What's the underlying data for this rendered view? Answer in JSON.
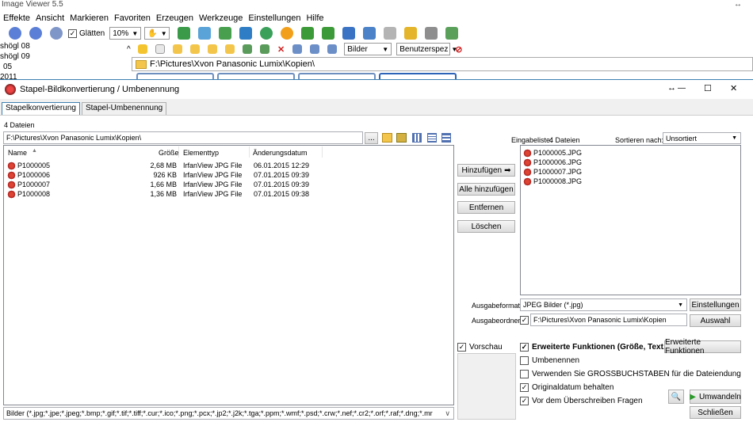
{
  "app": {
    "title": "Image Viewer 5.5",
    "maximize_glyph": "↔"
  },
  "menu": [
    "Effekte",
    "Ansicht",
    "Markieren",
    "Favoriten",
    "Erzeugen",
    "Werkzeuge",
    "Einstellungen",
    "Hilfe"
  ],
  "toolbar": {
    "smooth_label": "Glätten",
    "zoom_value": "10%",
    "view_mode": "Bilder",
    "sort_mode": "Benutzerspez"
  },
  "tree": [
    "shögl 08",
    "shögl 09",
    "05",
    "2011"
  ],
  "browser_path": "F:\\Pictures\\Xvon Panasonic Lumix\\Kopien\\",
  "dialog": {
    "title": "Stapel-Bildkonvertierung / Umbenennung",
    "window_controls": {
      "resize": "↔",
      "minimize": "—",
      "maximize": "☐",
      "close": "✕"
    },
    "tabs": [
      "Stapelkonvertierung",
      "Stapel-Umbenennung"
    ],
    "file_count": "4 Dateien",
    "path": "F:\\Pictures\\Xvon Panasonic Lumix\\Kopien\\",
    "browse_label": "...",
    "columns": {
      "name": "Name",
      "size": "Größe",
      "type": "Elementtyp",
      "date": "Änderungsdatum",
      "sort_glyph": "▲"
    },
    "files": [
      {
        "name": "P1000005",
        "size": "2,68 MB",
        "type": "IrfanView JPG File",
        "date": "06.01.2015 12:29"
      },
      {
        "name": "P1000006",
        "size": "926 KB",
        "type": "IrfanView JPG File",
        "date": "07.01.2015 09:39"
      },
      {
        "name": "P1000007",
        "size": "1,66 MB",
        "type": "IrfanView JPG File",
        "date": "07.01.2015 09:39"
      },
      {
        "name": "P1000008",
        "size": "1,36 MB",
        "type": "IrfanView JPG File",
        "date": "07.01.2015 09:38"
      }
    ],
    "filter": "Bilder (*.jpg;*.jpe;*.jpeg;*.bmp;*.gif;*.tif;*.tiff;*.cur;*.ico;*.png;*.pcx;*.jp2;*.j2k;*.tga;*.ppm;*.wmf;*.psd;*.crw;*.nef;*.cr2;*.orf;*.raf;*.dng;*.mr",
    "add_label": "Hinzufügen",
    "add_all_label": "Alle hinzufügen",
    "remove_label": "Entfernen",
    "clear_label": "Löschen",
    "input_list_label": "Eingabeliste:",
    "input_list_count": "4 Dateien",
    "sort_label": "Sortieren nach:",
    "sort_value": "Unsortiert",
    "input_files": [
      "P1000005.JPG",
      "P1000006.JPG",
      "P1000007.JPG",
      "P1000008.JPG"
    ],
    "output_format_label": "Ausgabeformat:",
    "output_format_value": "JPEG Bilder (*.jpg)",
    "settings_label": "Einstellungen",
    "output_folder_label": "Ausgabeordner:",
    "output_folder_value": "F:\\Pictures\\Xvon Panasonic Lumix\\Kopien",
    "choose_label": "Auswahl",
    "preview_label": "Vorschau",
    "advanced_check_label": "Erweiterte Funktionen (Größe, Text...)",
    "advanced_button_label": "Erweiterte Funktionen",
    "rename_label": "Umbenennen",
    "uppercase_label": "Verwenden Sie GROSSBUCHSTABEN für die Dateiendung",
    "keep_date_label": "Originaldatum behalten",
    "ask_overwrite_label": "Vor dem Überschreiben Fragen",
    "convert_label": "Umwandeln",
    "close_label": "Schließen",
    "check_glyph": "✓"
  }
}
